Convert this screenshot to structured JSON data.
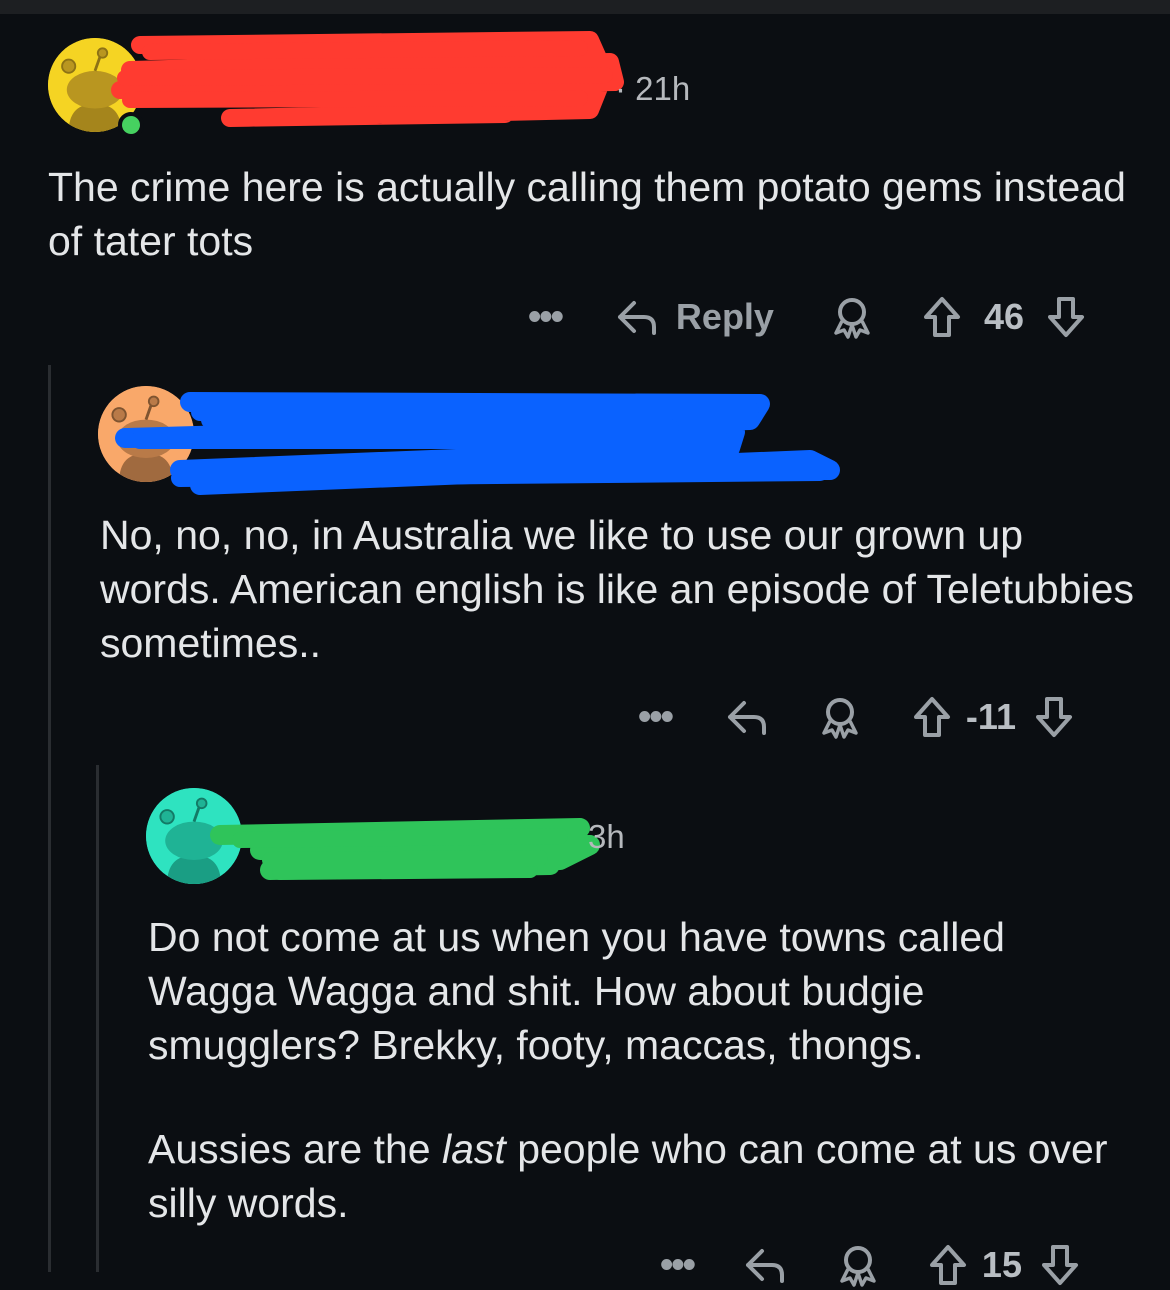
{
  "comments": [
    {
      "time": "· 21h",
      "text": "The crime here is actually calling them potato gems instead of tater tots",
      "vote_count": "46",
      "reply_label": "Reply",
      "avatar_color": "#f5d423",
      "redaction_color": "#ff3b30",
      "avatar_icon": "snoo-avatar-icon"
    },
    {
      "time": "",
      "text": "No, no, no, in Australia we like to use our grown up words. American english is like an episode of Teletubbies sometimes..",
      "vote_count": "-11",
      "avatar_color": "#f9a86a",
      "redaction_color": "#0a62ff",
      "avatar_icon": "snoo-avatar-icon"
    },
    {
      "time": "3h",
      "text_p1": "Do not come at us when you have towns called Wagga Wagga and shit. How about budgie smugglers? Brekky, footy, maccas, thongs.",
      "text_p2_before": "Aussies are the ",
      "text_p2_em": "last",
      "text_p2_after": " people who can come at us over silly words.",
      "vote_count": "15",
      "avatar_color": "#2ee3c0",
      "redaction_color": "#2fc45a",
      "avatar_icon": "snoo-avatar-icon"
    }
  ],
  "colors": {
    "background": "#0b0e12",
    "text": "#e4e6e8",
    "muted": "#9aa0a6",
    "thread_line": "#2a2d31"
  },
  "icons": [
    "more-options-icon",
    "reply-arrow-icon",
    "award-icon",
    "upvote-arrow-icon",
    "downvote-arrow-icon"
  ]
}
